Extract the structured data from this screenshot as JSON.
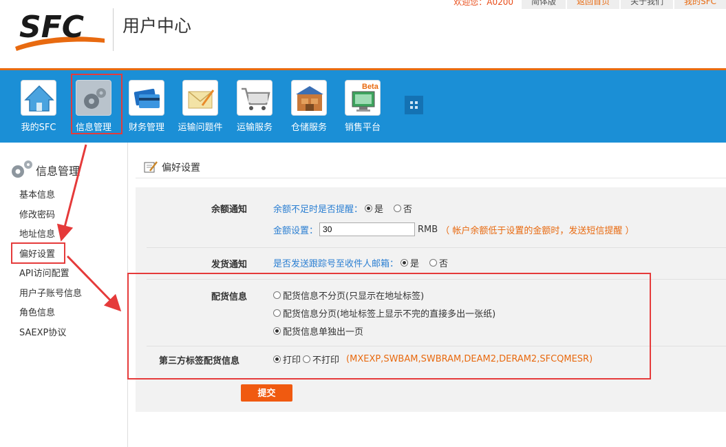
{
  "header": {
    "logo_text": "SFC",
    "title": "用户中心",
    "top_links": {
      "greeting": "欢迎您：A0200",
      "link1": "简体版",
      "link2": "返回首页",
      "link3": "关于我们",
      "link4": "我的SFC"
    }
  },
  "nav": {
    "items": [
      {
        "label": "我的SFC",
        "icon": "home-icon"
      },
      {
        "label": "信息管理",
        "icon": "gears-icon"
      },
      {
        "label": "财务管理",
        "icon": "cards-icon"
      },
      {
        "label": "运输问题件",
        "icon": "envelope-pencil-icon"
      },
      {
        "label": "运输服务",
        "icon": "shopping-cart-icon"
      },
      {
        "label": "仓储服务",
        "icon": "warehouse-icon"
      },
      {
        "label": "销售平台",
        "icon": "monitor-beta-icon",
        "badge": "Beta"
      }
    ],
    "active_index": 1
  },
  "sidebar": {
    "title": "信息管理",
    "items": [
      {
        "label": "基本信息"
      },
      {
        "label": "修改密码"
      },
      {
        "label": "地址信息"
      },
      {
        "label": "偏好设置"
      },
      {
        "label": "API访问配置"
      },
      {
        "label": "用户子账号信息"
      },
      {
        "label": "角色信息"
      },
      {
        "label": "SAEXP协议"
      }
    ],
    "current_index": 3
  },
  "main": {
    "title": "偏好设置",
    "balance": {
      "label": "余额通知",
      "question": "余额不足时是否提醒：",
      "yes": "是",
      "no": "否",
      "yes_checked": true,
      "amount_label": "金额设置：",
      "amount_value": "30",
      "unit": "RMB",
      "hint": "（ 帐户余额低于设置的金额时，发送短信提醒 ）"
    },
    "shipping": {
      "label": "发货通知",
      "question": "是否发送跟踪号至收件人邮箱：",
      "yes": "是",
      "no": "否",
      "yes_checked": true
    },
    "packing": {
      "label": "配货信息",
      "options": [
        "配货信息不分页(只显示在地址标签)",
        "配货信息分页(地址标签上显示不完的直接多出一张纸)",
        "配货信息单独出一页"
      ],
      "selected_index": 2
    },
    "third_party": {
      "label": "第三方标签配货信息",
      "print": "打印",
      "no_print": "不打印",
      "print_checked": true,
      "carriers": "(MXEXP,SWBAM,SWBRAM,DEAM2,DERAM2,SFCQMESR)"
    },
    "submit_label": "提交"
  },
  "colors": {
    "nav_blue": "#1b8fd6",
    "accent_orange": "#f05a10",
    "annotation_red": "#e53a3a",
    "link_blue": "#2b7fd2"
  }
}
